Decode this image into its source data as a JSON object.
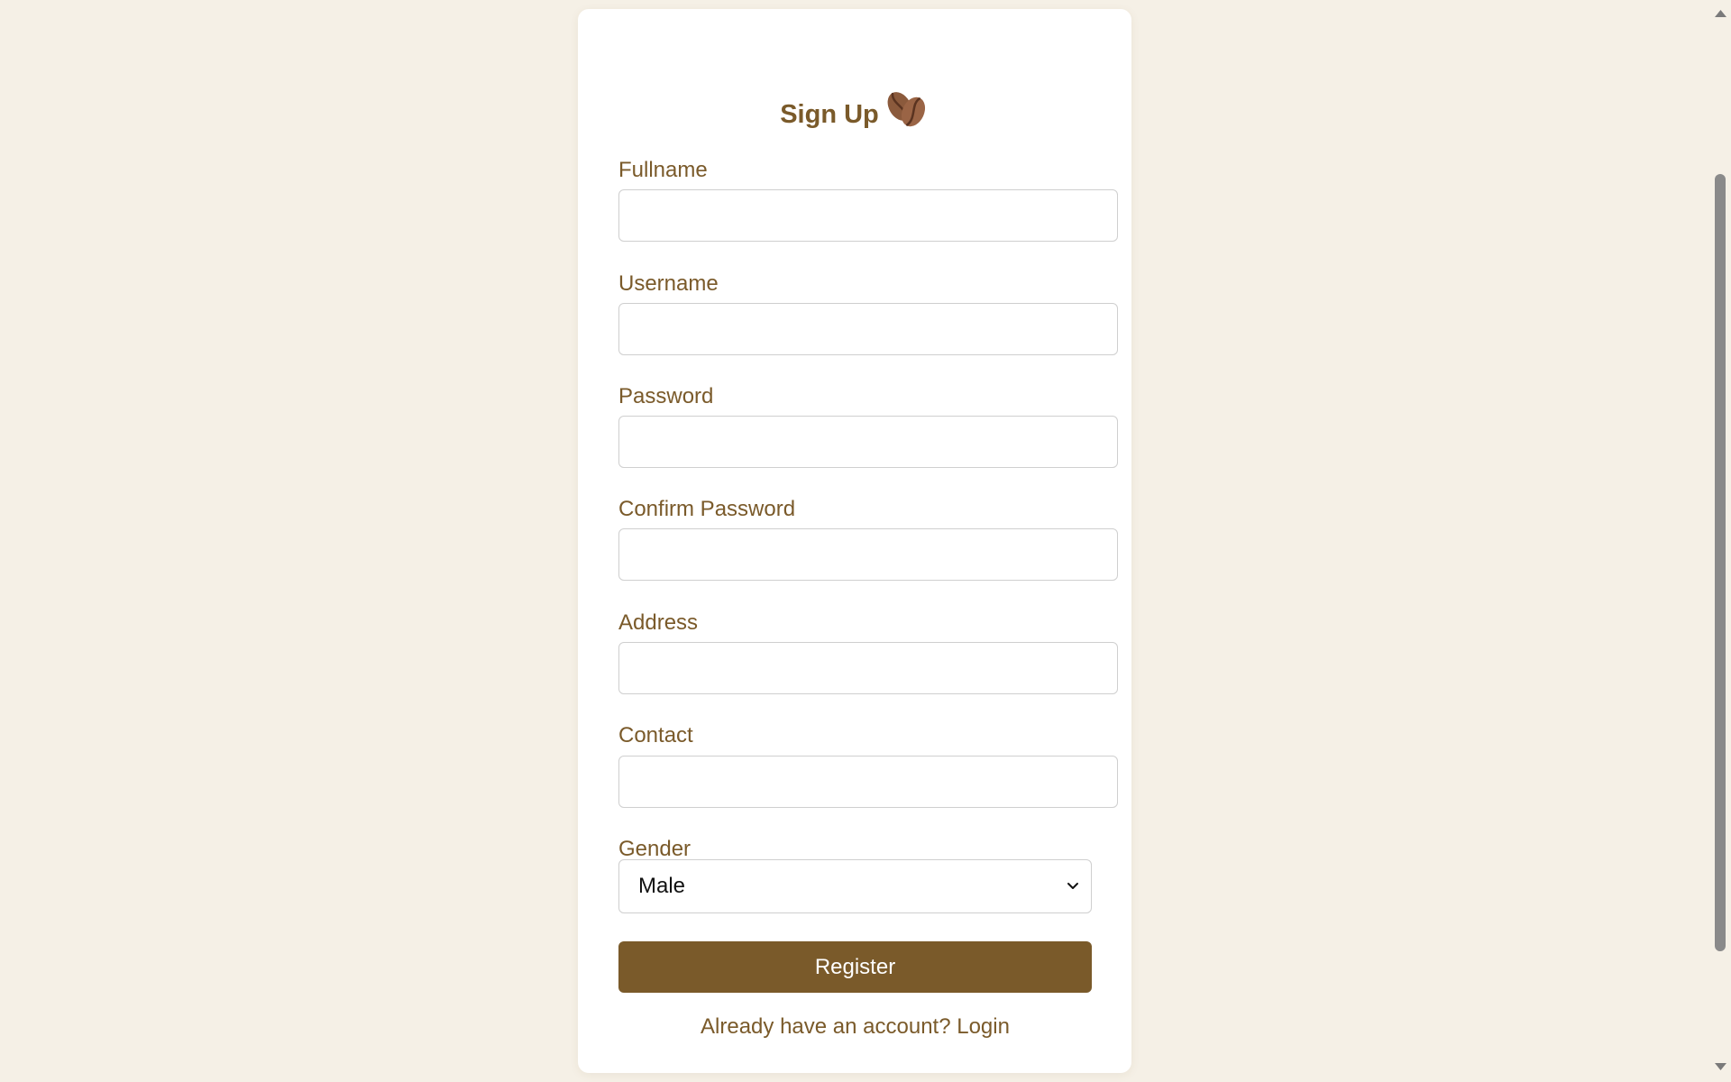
{
  "form": {
    "title": "Sign Up",
    "title_icon": "coffee-bean-icon",
    "fields": [
      {
        "label": "Fullname",
        "value": "",
        "type": "text"
      },
      {
        "label": "Username",
        "value": "",
        "type": "text"
      },
      {
        "label": "Password",
        "value": "",
        "type": "password"
      },
      {
        "label": "Confirm Password",
        "value": "",
        "type": "password"
      },
      {
        "label": "Address",
        "value": "",
        "type": "text"
      },
      {
        "label": "Contact",
        "value": "",
        "type": "text"
      }
    ],
    "gender": {
      "label": "Gender",
      "selected": "Male"
    },
    "register_label": "Register",
    "login_prompt": "Already have an account?",
    "login_link": "Login"
  },
  "colors": {
    "background": "#f5f0e6",
    "accent": "#7a5a2a",
    "card": "#ffffff"
  }
}
